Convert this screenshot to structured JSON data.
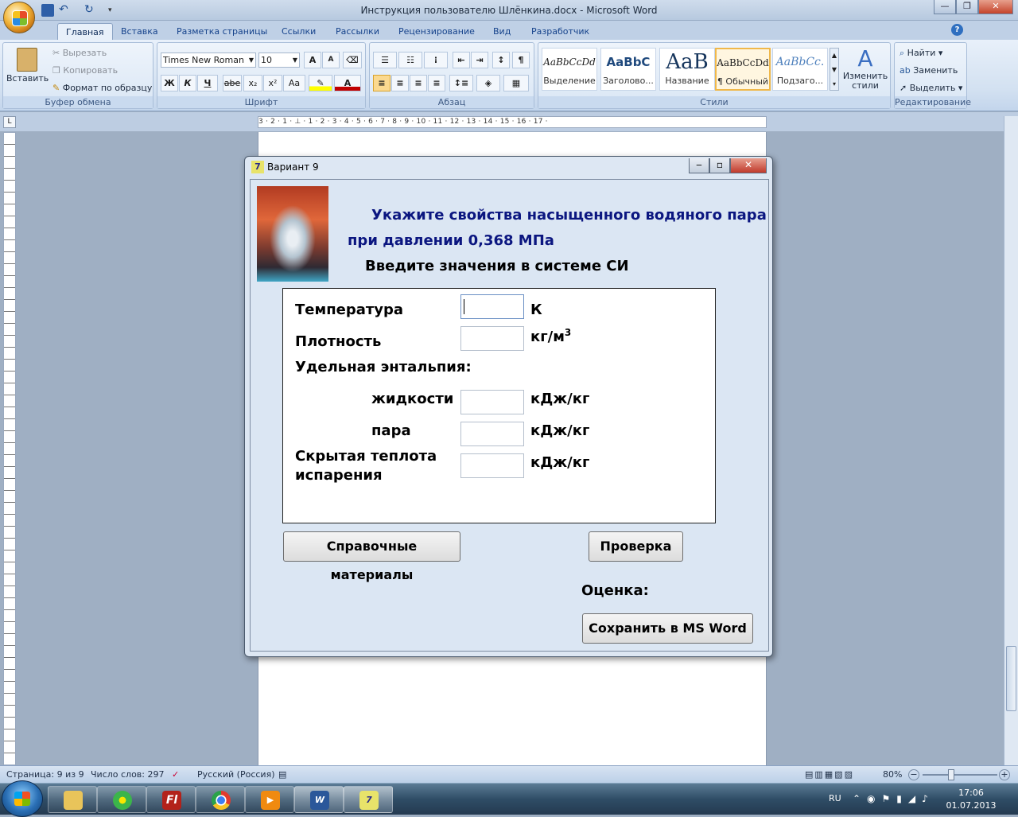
{
  "window": {
    "title": "Инструкция пользователю Шлёнкина.docx - Microsoft Word"
  },
  "ribbon": {
    "tabs": [
      "Главная",
      "Вставка",
      "Разметка страницы",
      "Ссылки",
      "Рассылки",
      "Рецензирование",
      "Вид",
      "Разработчик"
    ],
    "clipboard": {
      "paste": "Вставить",
      "cut": "Вырезать",
      "copy": "Копировать",
      "format_painter": "Формат по образцу",
      "label": "Буфер обмена"
    },
    "font": {
      "name": "Times New Roman",
      "size": "10",
      "bold": "Ж",
      "italic": "К",
      "underline": "Ч",
      "strike": "abe",
      "sub": "x₂",
      "sup": "x²",
      "case": "Aa",
      "label": "Шрифт"
    },
    "paragraph": {
      "label": "Абзац",
      "pilcrow": "¶"
    },
    "styles": {
      "items": [
        {
          "sample": "AaBbCcDd",
          "name": "Выделение"
        },
        {
          "sample": "AaBbC",
          "name": "Заголово..."
        },
        {
          "sample": "AaB",
          "name": "Название"
        },
        {
          "sample": "AaBbCcDd",
          "name": "¶ Обычный"
        },
        {
          "sample": "AaBbCc.",
          "name": "Подзаго..."
        }
      ],
      "change": "Изменить стили",
      "label": "Стили"
    },
    "editing": {
      "find": "Найти",
      "replace": "Заменить",
      "select": "Выделить",
      "label": "Редактирование"
    }
  },
  "ruler": {
    "marks": "3 · 2 · 1 · ⊥ · 1 · 2 · 3 · 4 · 5 · 6 · 7 · 8 · 9 · 10 · 11 · 12 · 13 · 14 · 15 · 16 · 17 ·"
  },
  "status": {
    "page": "Страница: 9 из 9",
    "words": "Число слов: 297",
    "lang": "Русский (Россия)",
    "zoom": "80%"
  },
  "taskbar": {
    "lang": "RU",
    "time": "17:06",
    "date": "01.07.2013"
  },
  "dialog": {
    "title": "Вариант 9",
    "heading1": "Укажите свойства насыщенного водяного пара",
    "heading2": "при давлении 0,368 МПа",
    "subheading": "Введите значения в системе СИ",
    "fields": [
      {
        "label": "Температура",
        "unit": "К"
      },
      {
        "label": "Плотность",
        "unit": "кг/м",
        "sup": "3"
      },
      {
        "label": "жидкости",
        "unit": "кДж/кг"
      },
      {
        "label": "пара",
        "unit": "кДж/кг"
      },
      {
        "label": "Скрытая теплота",
        "label2": "испарения",
        "unit": "кДж/кг"
      }
    ],
    "enthalpy_label": "Удельная энтальпия:",
    "ref_button": "Справочные материалы",
    "check_button": "Проверка",
    "grade_label": "Оценка:",
    "save_button": "Сохранить в MS Word"
  }
}
